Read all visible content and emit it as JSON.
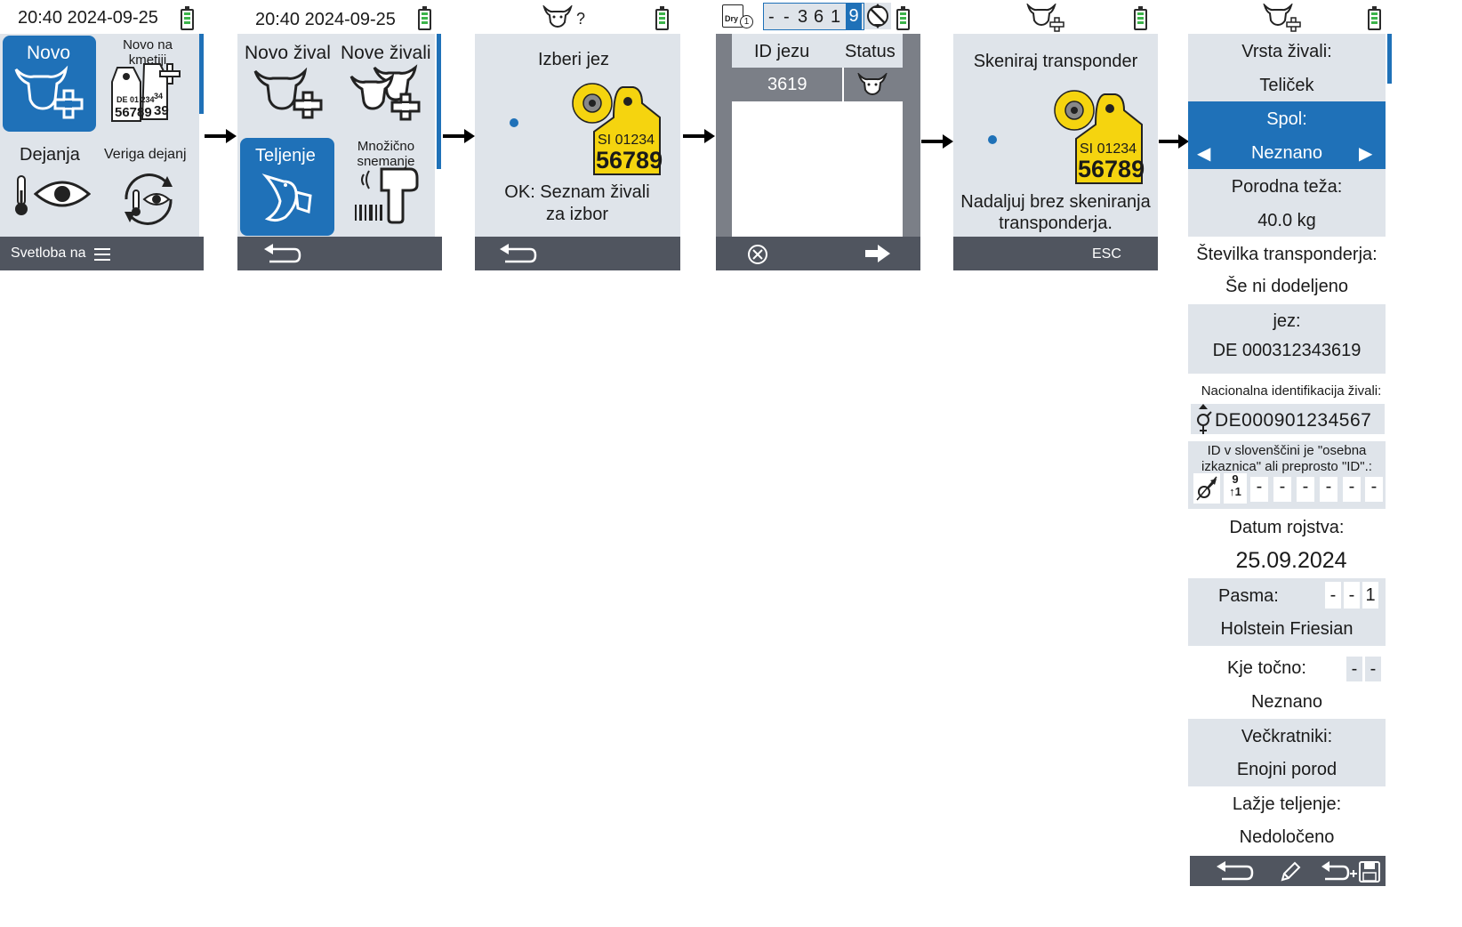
{
  "screen1": {
    "datetime": "20:40 2024-09-25",
    "tiles": {
      "new": "Novo",
      "new_on_farm": "Novo na kmetiji",
      "actions": "Dejanja",
      "action_chain": "Veriga dejanj"
    },
    "tag_line1": "DE 01 234",
    "tag_line2": "56789",
    "tag_partial": "34",
    "tag_partial2": "39",
    "bottom_label": "Svetloba na"
  },
  "screen2": {
    "datetime": "20:40 2024-09-25",
    "tiles": {
      "new_animal": "Novo žival",
      "new_animals": "Nove živali",
      "calving": "Teljenje",
      "bulk_capture": "Množično snemanje"
    }
  },
  "screen3": {
    "status_mark": "?",
    "title": "Izberi jez",
    "tag_line1": "SI 01234",
    "tag_line2": "56789",
    "hint_line1": "OK: Seznam živali",
    "hint_line2": "za izbor"
  },
  "screen4": {
    "dry_label": "Dry",
    "dry_count": "1",
    "id_entry": [
      "-",
      "-",
      "3",
      "6",
      "1",
      "9"
    ],
    "col_id": "ID jezu",
    "col_status": "Status",
    "rows": [
      {
        "id": "3619"
      }
    ]
  },
  "screen5": {
    "title": "Skeniraj transponder",
    "tag_line1": "SI 01234",
    "tag_line2": "56789",
    "hint_line1": "Nadaljuj brez skeniranja",
    "hint_line2": "transponderja.",
    "esc": "ESC"
  },
  "screen6": {
    "species_label": "Vrsta živali:",
    "species_value": "Teliček",
    "sex_label": "Spol:",
    "sex_value": "Neznano",
    "birth_weight_label": "Porodna teža:",
    "birth_weight_value": "40.0 kg",
    "transponder_label": "Številka transponderja:",
    "transponder_value": "Še ni dodeljeno",
    "dam_label": "jez:",
    "dam_value": "DE 000312343619",
    "national_id_label": "Nacionalna identifikacija živali:",
    "national_id_value": "DE000901234567",
    "id_note_line1": "ID v slovenščini je \"osebna",
    "id_note_line2": "izkaznica\" ali preprosto \"ID\".:",
    "id_note_cells": [
      "-",
      "-",
      "-",
      "-",
      "-",
      "-"
    ],
    "birth_date_label": "Datum rojstva:",
    "birth_date_value": "25.09.2024",
    "breed_label": "Pasma:",
    "breed_cells": [
      "-",
      "-",
      "1"
    ],
    "breed_value": "Holstein Friesian",
    "where_label": "Kje točno:",
    "where_cells": [
      "-",
      "-"
    ],
    "where_value": "Neznano",
    "multiples_label": "Večkratniki:",
    "multiples_value": "Enojni porod",
    "easy_calving_label": "Lažje teljenje:",
    "easy_calving_value": "Nedoločeno"
  },
  "colors": {
    "accent": "#1f71b8",
    "panel": "#dfe4ea",
    "bar": "#50555f",
    "tag_yellow": "#f5d40f",
    "battery_green": "#3cb34a"
  },
  "icons": [
    "battery-icon",
    "cow-plus-icon",
    "ear-tag-icon",
    "thermometer-icon",
    "eye-icon",
    "cycle-icon",
    "stork-icon",
    "scanner-icon",
    "back-icon",
    "cancel-icon",
    "next-icon",
    "menu-icon",
    "pencil-icon",
    "save-icon"
  ]
}
